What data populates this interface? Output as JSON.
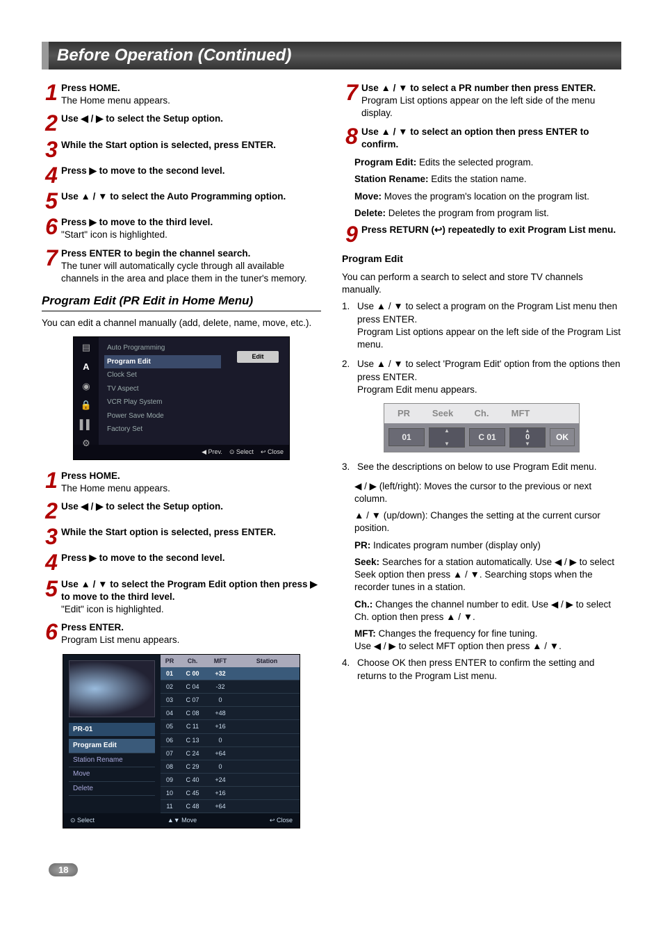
{
  "header": {
    "title": "Before Operation (Continued)"
  },
  "left": {
    "s1": {
      "bold": "Press HOME.",
      "text": "The Home menu appears."
    },
    "s2": {
      "bold": "Use ◀ / ▶ to select the Setup option."
    },
    "s3": {
      "bold": "While the Start option is selected, press ENTER."
    },
    "s4": {
      "bold": "Press ▶ to move to the second level."
    },
    "s5": {
      "bold": "Use ▲ / ▼ to select the Auto Programming option."
    },
    "s6": {
      "bold": "Press ▶ to move to the third level.",
      "text": "\"Start\" icon is highlighted."
    },
    "s7": {
      "bold": "Press ENTER to begin the channel search.",
      "text": "The tuner will automatically cycle through all available channels in the area and place them in the tuner's memory."
    },
    "subheading": "Program Edit (PR Edit in Home Menu)",
    "intro2": "You can edit a channel manually (add, delete, name, move, etc.).",
    "b1": {
      "bold": "Press HOME.",
      "text": "The Home menu appears."
    },
    "b2": {
      "bold": "Use ◀ / ▶ to select the Setup option."
    },
    "b3": {
      "bold": "While the Start option is selected, press ENTER."
    },
    "b4": {
      "bold": "Press ▶ to move to the second level."
    },
    "b5": {
      "bold": "Use ▲ / ▼ to select the Program Edit option then press ▶ to move to the third level.",
      "text": "\"Edit\" icon is highlighted."
    },
    "b6": {
      "bold": "Press ENTER.",
      "text": "Program List menu appears."
    }
  },
  "right": {
    "s7": {
      "bold": "Use ▲ / ▼ to select a PR number then press ENTER.",
      "text": "Program List options appear on the left side of the menu display."
    },
    "s8": {
      "bold": "Use ▲ / ▼ to select an option then press ENTER to confirm."
    },
    "opt1": {
      "b": "Program Edit:",
      "t": " Edits the selected program."
    },
    "opt2": {
      "b": "Station Rename:",
      "t": " Edits the station name."
    },
    "opt3": {
      "b": "Move:",
      "t": " Moves the program's location on the program list."
    },
    "opt4": {
      "b": "Delete:",
      "t": " Deletes the program from program list."
    },
    "s9": {
      "bold": "Press RETURN (↩) repeatedly to exit Program List menu."
    },
    "pe_heading": "Program Edit",
    "pe_intro": "You can perform a search to select and store TV channels manually.",
    "n1a": "Use ▲ / ▼ to select a program on the Program List menu then press ENTER.",
    "n1b": "Program List options appear on the left side of the Program List menu.",
    "n2a": "Use ▲ / ▼ to select 'Program Edit' option from the options then press ENTER.",
    "n2b": "Program Edit menu appears.",
    "n3": "See the descriptions on below to use Program Edit menu.",
    "d_lr": "◀ / ▶ (left/right): Moves the cursor to the previous or next column.",
    "d_ud": "▲ / ▼ (up/down): Changes the setting at the current cursor position.",
    "d_pr": {
      "b": "PR:",
      "t": " Indicates program number (display only)"
    },
    "d_seek": {
      "b": "Seek:",
      "t": " Searches for a station automatically. Use ◀ / ▶ to select Seek option then press ▲ / ▼. Searching stops when the recorder tunes in a station."
    },
    "d_ch": {
      "b": "Ch.:",
      "t": " Changes the channel number to edit. Use ◀ / ▶ to select Ch. option then press ▲ / ▼."
    },
    "d_mft1": {
      "b": "MFT:",
      "t": " Changes the frequency for fine tuning."
    },
    "d_mft2": "Use ◀ / ▶ to select MFT option then press ▲ / ▼.",
    "n4": "Choose OK then press ENTER to confirm the setting and returns to the Program List menu."
  },
  "shot1": {
    "menu": [
      "Auto Programming",
      "Program Edit",
      "Clock Set",
      "TV Aspect",
      "VCR Play System",
      "Power Save Mode",
      "Factory Set"
    ],
    "btn": "Edit",
    "footer": [
      "◀ Prev.",
      "⊙ Select",
      "↩ Close"
    ]
  },
  "shot2": {
    "prlabel": "PR-01",
    "opts": [
      "Program Edit",
      "Station Rename",
      "Move",
      "Delete"
    ],
    "columns": [
      "PR",
      "Ch.",
      "MFT",
      "Station"
    ],
    "rows": [
      {
        "pr": "01",
        "ch": "C 00",
        "mft": "+32",
        "st": ""
      },
      {
        "pr": "02",
        "ch": "C 04",
        "mft": "-32",
        "st": ""
      },
      {
        "pr": "03",
        "ch": "C 07",
        "mft": "0",
        "st": ""
      },
      {
        "pr": "04",
        "ch": "C 08",
        "mft": "+48",
        "st": ""
      },
      {
        "pr": "05",
        "ch": "C 11",
        "mft": "+16",
        "st": ""
      },
      {
        "pr": "06",
        "ch": "C 13",
        "mft": "0",
        "st": ""
      },
      {
        "pr": "07",
        "ch": "C 24",
        "mft": "+64",
        "st": ""
      },
      {
        "pr": "08",
        "ch": "C 29",
        "mft": "0",
        "st": ""
      },
      {
        "pr": "09",
        "ch": "C 40",
        "mft": "+24",
        "st": ""
      },
      {
        "pr": "10",
        "ch": "C 45",
        "mft": "+16",
        "st": ""
      },
      {
        "pr": "11",
        "ch": "C 48",
        "mft": "+64",
        "st": ""
      }
    ],
    "footer_left": "⊙ Select",
    "footer_mid": "▲▼ Move",
    "footer_right": "↩ Close"
  },
  "shot3": {
    "headers": [
      "PR",
      "Seek",
      "Ch.",
      "MFT"
    ],
    "pr": "01",
    "ch": "C 01",
    "mft": "0",
    "ok": "OK"
  },
  "page_number": "18"
}
